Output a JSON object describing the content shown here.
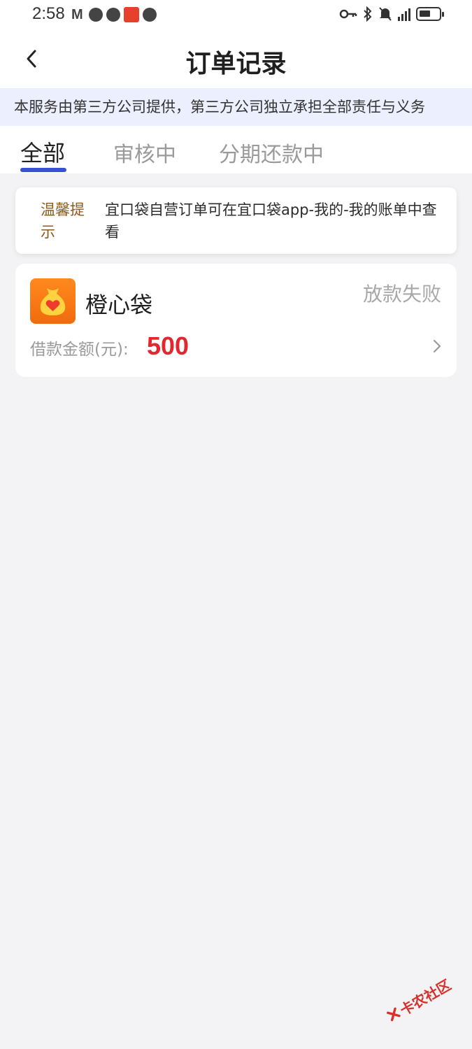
{
  "status_bar": {
    "time": "2:58",
    "gmail_glyph": "M",
    "icons": [
      "gmail-icon",
      "message-icon",
      "chat-icon",
      "app-notification-icon",
      "chat-icon",
      "key-icon",
      "bluetooth-icon",
      "mute-icon",
      "signal-icon",
      "battery-icon"
    ]
  },
  "header": {
    "title": "订单记录",
    "back_icon": "chevron-left-icon"
  },
  "notice": {
    "text": "本服务由第三方公司提供，第三方公司独立承担全部责任与义务"
  },
  "tabs": [
    {
      "label": "全部",
      "active": true
    },
    {
      "label": "审核中",
      "active": false
    },
    {
      "label": "分期还款中",
      "active": false
    }
  ],
  "tip": {
    "label": "温馨提示",
    "text": "宜口袋自营订单可在宜口袋app-我的-我的账单中查看"
  },
  "orders": [
    {
      "app_name": "橙心袋",
      "status": "放款失败",
      "amount_label": "借款金额(元):",
      "amount": "500",
      "logo_icon": "money-bag-heart-icon"
    }
  ],
  "watermark": {
    "text": "卡农社区"
  },
  "colors": {
    "accent": "#3a4fd7",
    "amount_red": "#e0282e",
    "tip_label": "#8a5a1f",
    "banner_bg": "#eceffd",
    "logo_orange": "#f26a0d"
  }
}
